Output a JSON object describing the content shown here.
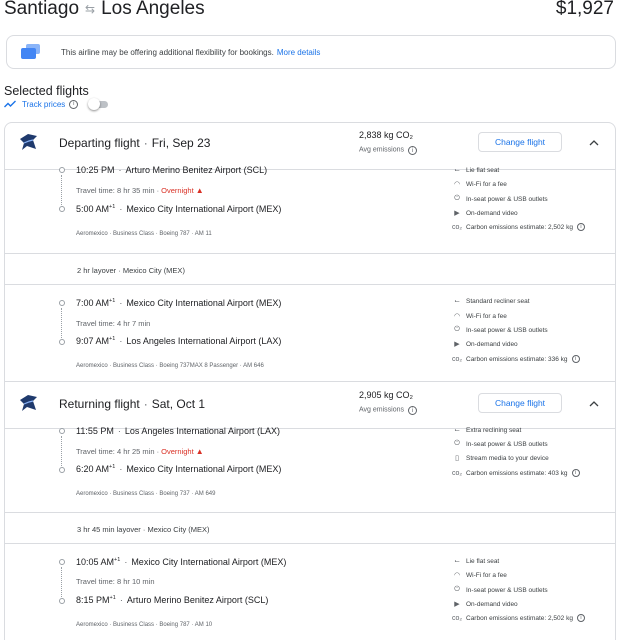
{
  "header": {
    "origin": "Santiago",
    "destination": "Los Angeles",
    "price": "$1,927"
  },
  "notice": {
    "text": "This airline may be offering additional flexibility for bookings.",
    "link": "More details"
  },
  "selected": {
    "title": "Selected flights",
    "track_label": "Track prices",
    "track_enabled": false
  },
  "departing": {
    "label": "Departing flight",
    "date": "Fri, Sep 23",
    "co2": "2,838 kg CO₂",
    "co2_sub": "Avg emissions",
    "change_label": "Change flight",
    "segments": [
      {
        "dep_time": "10:25 PM",
        "dep_sup": "",
        "dep_airport": "Arturo Merino Benitez Airport (SCL)",
        "travel": "Travel time: 8 hr 35 min",
        "overnight": "Overnight",
        "arr_time": "5:00 AM",
        "arr_sup": "+1",
        "arr_airport": "Mexico City International Airport (MEX)",
        "airline": "Aeromexico",
        "cabin": "Business Class",
        "aircraft": "Boeing 787",
        "flight_no": "AM 11",
        "amenities": [
          "Lie flat seat",
          "Wi-Fi for a fee",
          "In-seat power & USB outlets",
          "On-demand video",
          "Carbon emissions estimate: 2,502 kg"
        ]
      },
      {
        "dep_time": "7:00 AM",
        "dep_sup": "+1",
        "dep_airport": "Mexico City International Airport (MEX)",
        "travel": "Travel time: 4 hr 7 min",
        "overnight": "",
        "arr_time": "9:07 AM",
        "arr_sup": "+1",
        "arr_airport": "Los Angeles International Airport (LAX)",
        "airline": "Aeromexico",
        "cabin": "Business Class",
        "aircraft": "Boeing 737MAX 8 Passenger",
        "flight_no": "AM 646",
        "amenities": [
          "Standard recliner seat",
          "Wi-Fi for a fee",
          "In-seat power & USB outlets",
          "On-demand video",
          "Carbon emissions estimate: 336 kg"
        ]
      }
    ],
    "layover": "2 hr layover · Mexico City (MEX)"
  },
  "returning": {
    "label": "Returning flight",
    "date": "Sat, Oct 1",
    "co2": "2,905 kg CO₂",
    "co2_sub": "Avg emissions",
    "change_label": "Change flight",
    "segments": [
      {
        "dep_time": "11:55 PM",
        "dep_sup": "",
        "dep_airport": "Los Angeles International Airport (LAX)",
        "travel": "Travel time: 4 hr 25 min",
        "overnight": "Overnight",
        "arr_time": "6:20 AM",
        "arr_sup": "+1",
        "arr_airport": "Mexico City International Airport (MEX)",
        "airline": "Aeromexico",
        "cabin": "Business Class",
        "aircraft": "Boeing 737",
        "flight_no": "AM 649",
        "amenities": [
          "Extra reclining seat",
          "In-seat power & USB outlets",
          "Stream media to your device",
          "Carbon emissions estimate: 403 kg"
        ]
      },
      {
        "dep_time": "10:05 AM",
        "dep_sup": "+1",
        "dep_airport": "Mexico City International Airport (MEX)",
        "travel": "Travel time: 8 hr 10 min",
        "overnight": "",
        "arr_time": "8:15 PM",
        "arr_sup": "+1",
        "arr_airport": "Arturo Merino Benitez Airport (SCL)",
        "airline": "Aeromexico",
        "cabin": "Business Class",
        "aircraft": "Boeing 787",
        "flight_no": "AM 10",
        "amenities": [
          "Lie flat seat",
          "Wi-Fi for a fee",
          "In-seat power & USB outlets",
          "On-demand video",
          "Carbon emissions estimate: 2,502 kg"
        ]
      }
    ],
    "layover": "3 hr 45 min layover · Mexico City (MEX)"
  },
  "icons": {
    "logo": "aeromexico-logo",
    "swap": "swap-arrows-icon",
    "chevron": "chevron-up-icon"
  },
  "colors": {
    "accent": "#1a73e8",
    "warning": "#d93025"
  }
}
